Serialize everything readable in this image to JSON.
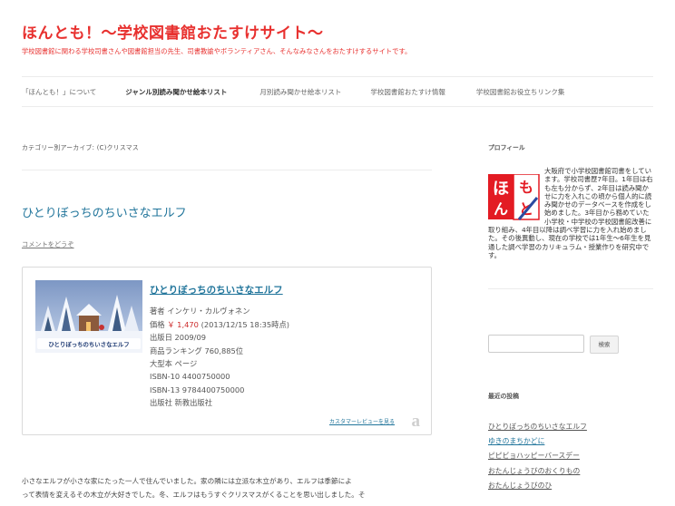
{
  "header": {
    "title": "ほんとも！～学校図書館おたすけサイト～",
    "description": "学校図書館に関わる学校司書さんや図書館担当の先生、司書教諭やボランティアさん、そんなみなさんをおたすけするサイトです。"
  },
  "nav": {
    "items": [
      {
        "label": "「ほんとも！」について"
      },
      {
        "label": "ジャンル別読み聞かせ絵本リスト"
      },
      {
        "label": "月別読み聞かせ絵本リスト"
      },
      {
        "label": "学校図書館おたすけ情報"
      },
      {
        "label": "学校図書館お役立ちリンク集"
      }
    ]
  },
  "archive": {
    "title": "カテゴリー別アーカイブ: (C)クリスマス"
  },
  "post": {
    "title": "ひとりぼっちのちいさなエルフ",
    "comment_link": "コメントをどうぞ",
    "book": {
      "cover_caption": "ひとりぼっちのちいさなエルフ",
      "title": "ひとりぼっちのちいさなエルフ",
      "author": "著者 インケリ・カルヴォネン",
      "price_label": "価格",
      "price_value": "￥ 1,470",
      "price_date": "(2013/12/15 18:35時点)",
      "release": "出版日 2009/09",
      "ranking": "商品ランキング 760,885位",
      "format": "大型本 ページ",
      "isbn10": "ISBN-10 4400750000",
      "isbn13": "ISBN-13 9784400750000",
      "publisher": "出版社 新教出版社",
      "review_link": "カスタマーレビューを見る",
      "amazon_glyph": "a"
    },
    "body": [
      "小さなエルフが小さな家にたった一人で住んでいました。家の隣には立派な木立があり、エルフは季節によ",
      "って表情を変えるその木立が大好きでした。冬、エルフはもうすぐクリスマスがくることを思い出しました。そ"
    ]
  },
  "sidebar": {
    "profile_heading": "プロフィール",
    "logo": {
      "chars": [
        "ほ",
        "ん",
        "と",
        "も"
      ]
    },
    "profile_text": "大阪府で小学校図書館司書をしています。学校司書歴7年目。1年目は右も左も分からず、2年目は読み聞かせに力を入れこの頃から個人的に読み聞かせのデータベースを作成をし始めました。3年目から務めていた小学校・中学校の学校図書館改善に取り組み、4年目以降は調べ学習に力を入れ始めました。その後異動し、現在の学校では1年生～6年生を見通した調べ学習のカリキュラム・授業作りを研究中です。",
    "search": {
      "button_label": "検索",
      "value": ""
    },
    "recent_heading": "最近の投稿",
    "recent_posts": [
      {
        "label": "ひとりぼっちのちいさなエルフ"
      },
      {
        "label": "ゆきのまちかどに"
      },
      {
        "label": "ピピビョハッピーバースデー"
      },
      {
        "label": "おたんじょうびのおくりもの"
      },
      {
        "label": "おたんじょうびのひ"
      }
    ]
  },
  "colors": {
    "accent_red": "#e8312f",
    "link_blue": "#21759b",
    "logo_red": "#e31b23",
    "price_red": "#cc2a2a"
  }
}
